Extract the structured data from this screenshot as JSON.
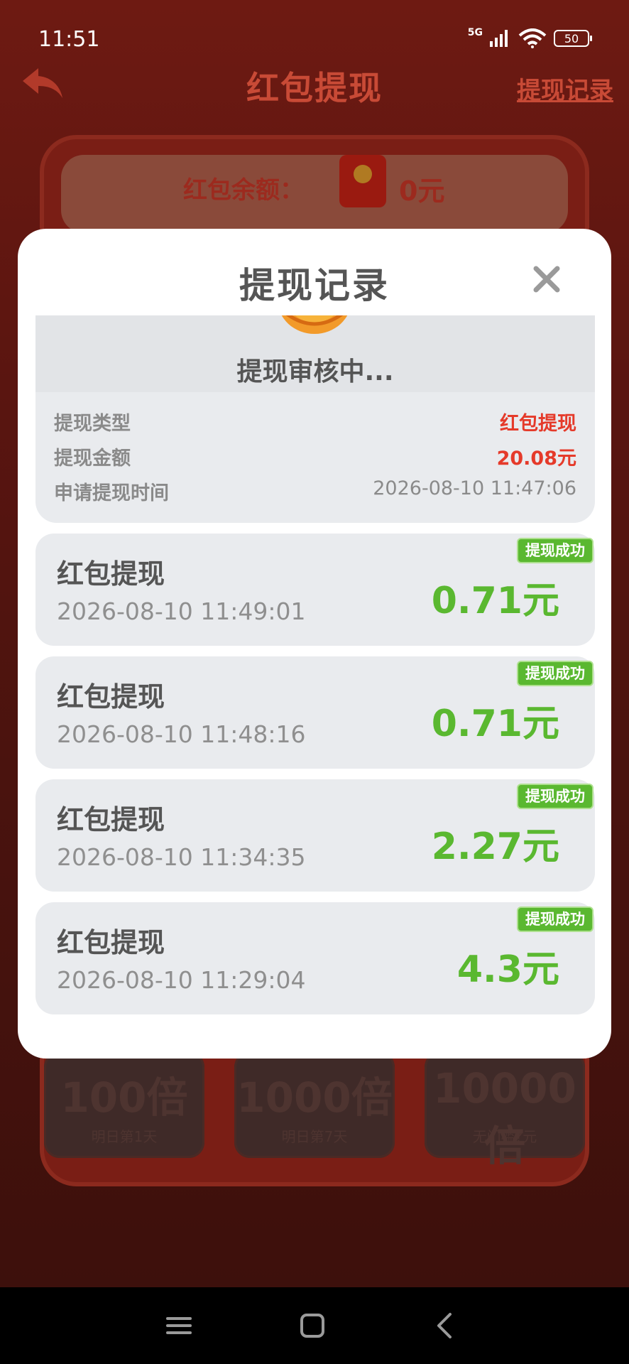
{
  "status_bar": {
    "time": "11:51",
    "network": "5G",
    "battery": "50"
  },
  "background": {
    "title": "红包提现",
    "record_link": "提现记录",
    "balance_label": "红包余额：",
    "balance_value": "0元",
    "tiles": [
      {
        "multiplier": "100倍",
        "caption": "明日第1天"
      },
      {
        "multiplier": "1000倍",
        "caption": "明日第7天"
      },
      {
        "multiplier": "10000倍",
        "caption": "无门槛?元"
      }
    ]
  },
  "modal": {
    "title": "提现记录",
    "pending": {
      "status": "提现审核中...",
      "rows": [
        {
          "key": "提现类型",
          "value": "红包提现"
        },
        {
          "key": "提现金额",
          "value": "20.08元"
        },
        {
          "key": "申请提现时间",
          "value": "2026-08-10 11:47:06"
        }
      ]
    },
    "records": [
      {
        "name": "红包提现",
        "time": "2026-08-10 11:49:01",
        "amount": "0.71元",
        "status": "提现成功"
      },
      {
        "name": "红包提现",
        "time": "2026-08-10 11:48:16",
        "amount": "0.71元",
        "status": "提现成功"
      },
      {
        "name": "红包提现",
        "time": "2026-08-10 11:34:35",
        "amount": "2.27元",
        "status": "提现成功"
      },
      {
        "name": "红包提现",
        "time": "2026-08-10 11:29:04",
        "amount": "4.3元",
        "status": "提现成功"
      }
    ]
  },
  "colors": {
    "accent_red": "#e53a2a",
    "success_green": "#5ab830",
    "text_gray": "#555555"
  }
}
